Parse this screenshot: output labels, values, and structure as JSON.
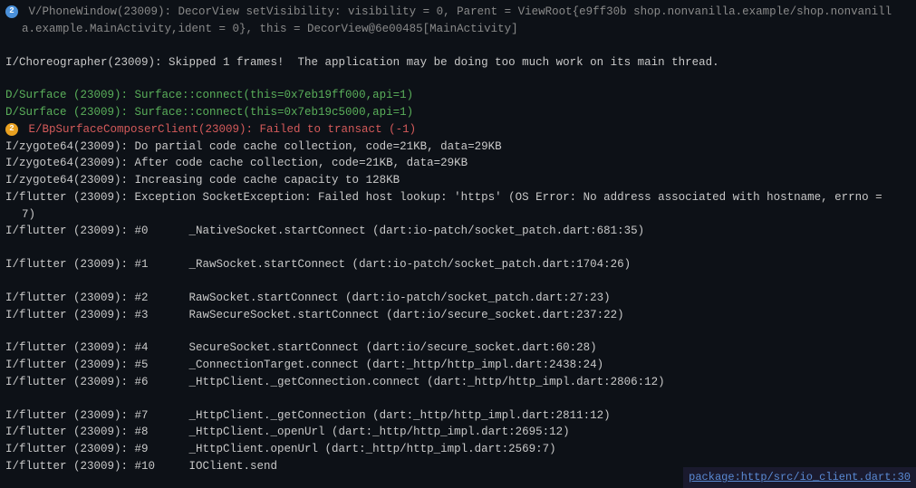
{
  "logs": [
    {
      "id": "line1",
      "badge": "2",
      "badge_type": "blue",
      "content": " V/PhoneWindow(23009): DecorView setVisibility: visibility = 0, Parent = ViewRoot{e9ff30b shop.nonvanilla.example/shop.nonvanill",
      "color": "gray"
    },
    {
      "id": "line1b",
      "badge": null,
      "content": "a.example.MainActivity,ident = 0}, this = DecorView@6e00485[MainActivity]",
      "color": "gray",
      "indent": true
    },
    {
      "id": "line_empty1",
      "empty": true
    },
    {
      "id": "line2",
      "badge": null,
      "content": "I/Choreographer(23009): Skipped 1 frames!  The application may be doing too much work on its main thread.",
      "color": "white"
    },
    {
      "id": "line_empty2",
      "empty": true
    },
    {
      "id": "line3",
      "badge": null,
      "content": "D/Surface (23009): Surface::connect(this=0x7eb19ff000,api=1)",
      "color": "green"
    },
    {
      "id": "line4",
      "badge": null,
      "content": "D/Surface (23009): Surface::connect(this=0x7eb19c5000,api=1)",
      "color": "green"
    },
    {
      "id": "line5",
      "badge": "2",
      "badge_type": "orange",
      "content": " E/BpSurfaceComposerClient(23009): Failed to transact (-1)",
      "color": "red"
    },
    {
      "id": "line6",
      "badge": null,
      "content": "I/zygote64(23009): Do partial code cache collection, code=21KB, data=29KB",
      "color": "white"
    },
    {
      "id": "line7",
      "badge": null,
      "content": "I/zygote64(23009): After code cache collection, code=21KB, data=29KB",
      "color": "white"
    },
    {
      "id": "line8",
      "badge": null,
      "content": "I/zygote64(23009): Increasing code cache capacity to 128KB",
      "color": "white"
    },
    {
      "id": "line9",
      "badge": null,
      "content": "I/flutter (23009): Exception SocketException: Failed host lookup: 'https' (OS Error: No address associated with hostname, errno =",
      "color": "white"
    },
    {
      "id": "line9b",
      "badge": null,
      "content": "7)",
      "color": "white",
      "indent": true
    },
    {
      "id": "line10",
      "badge": null,
      "content": "I/flutter (23009): #0      _NativeSocket.startConnect (dart:io-patch/socket_patch.dart:681:35)",
      "color": "white"
    },
    {
      "id": "line_empty3",
      "empty": true
    },
    {
      "id": "line11",
      "badge": null,
      "content": "I/flutter (23009): #1      _RawSocket.startConnect (dart:io-patch/socket_patch.dart:1704:26)",
      "color": "white"
    },
    {
      "id": "line_empty4",
      "empty": true
    },
    {
      "id": "line12",
      "badge": null,
      "content": "I/flutter (23009): #2      RawSocket.startConnect (dart:io-patch/socket_patch.dart:27:23)",
      "color": "white"
    },
    {
      "id": "line13",
      "badge": null,
      "content": "I/flutter (23009): #3      RawSecureSocket.startConnect (dart:io/secure_socket.dart:237:22)",
      "color": "white"
    },
    {
      "id": "line_empty5",
      "empty": true
    },
    {
      "id": "line14",
      "badge": null,
      "content": "I/flutter (23009): #4      SecureSocket.startConnect (dart:io/secure_socket.dart:60:28)",
      "color": "white"
    },
    {
      "id": "line15",
      "badge": null,
      "content": "I/flutter (23009): #5      _ConnectionTarget.connect (dart:_http/http_impl.dart:2438:24)",
      "color": "white"
    },
    {
      "id": "line16",
      "badge": null,
      "content": "I/flutter (23009): #6      _HttpClient._getConnection.connect (dart:_http/http_impl.dart:2806:12)",
      "color": "white"
    },
    {
      "id": "line_empty6",
      "empty": true
    },
    {
      "id": "line17",
      "badge": null,
      "content": "I/flutter (23009): #7      _HttpClient._getConnection (dart:_http/http_impl.dart:2811:12)",
      "color": "white"
    },
    {
      "id": "line18",
      "badge": null,
      "content": "I/flutter (23009): #8      _HttpClient._openUrl (dart:_http/http_impl.dart:2695:12)",
      "color": "white"
    },
    {
      "id": "line19",
      "badge": null,
      "content": "I/flutter (23009): #9      _HttpClient.openUrl (dart:_http/http_impl.dart:2569:7)",
      "color": "white"
    },
    {
      "id": "line20",
      "badge": null,
      "content": "I/flutter (23009): #10     IOClient.send",
      "color": "white"
    }
  ],
  "bottom_link": {
    "text": "package:http/src/io_client.dart:30",
    "href": "#"
  }
}
